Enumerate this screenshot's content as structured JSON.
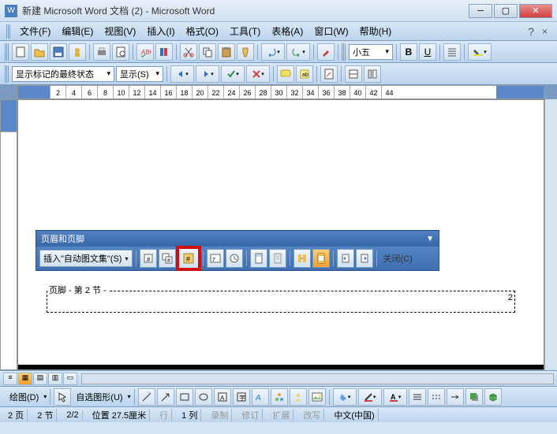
{
  "titlebar": {
    "title": "新建 Microsoft Word 文档 (2) - Microsoft Word"
  },
  "menubar": {
    "items": [
      "文件(F)",
      "编辑(E)",
      "视图(V)",
      "插入(I)",
      "格式(O)",
      "工具(T)",
      "表格(A)",
      "窗口(W)",
      "帮助(H)"
    ]
  },
  "toolbar2": {
    "state_label": "显示标记的最终状态",
    "show_label": "显示(S)"
  },
  "format": {
    "font_size": "小五",
    "bold": "B",
    "underline": "U"
  },
  "ruler": {
    "marks": [
      "",
      "2",
      "4",
      "6",
      "8",
      "10",
      "12",
      "14",
      "16",
      "18",
      "20",
      "22",
      "24",
      "26",
      "28",
      "30",
      "32",
      "34",
      "36",
      "38",
      "40",
      "42",
      "44"
    ]
  },
  "hf_toolbar": {
    "title": "页眉和页脚",
    "insert_label": "插入\"自动图文集\"(S)",
    "close_label": "关闭(C)"
  },
  "footer": {
    "label": "页脚 - 第 2 节 -",
    "page_num": "2"
  },
  "drawbar": {
    "draw_label": "绘图(D)",
    "shapes_label": "自选图形(U)"
  },
  "statusbar": {
    "page": "2 页",
    "section": "2 节",
    "pages": "2/2",
    "position": "位置 27.5厘米",
    "line": "行",
    "col": "1 列",
    "rec": "录制",
    "rev": "修订",
    "ext": "扩展",
    "ovr": "改写",
    "lang": "中文(中国)"
  }
}
